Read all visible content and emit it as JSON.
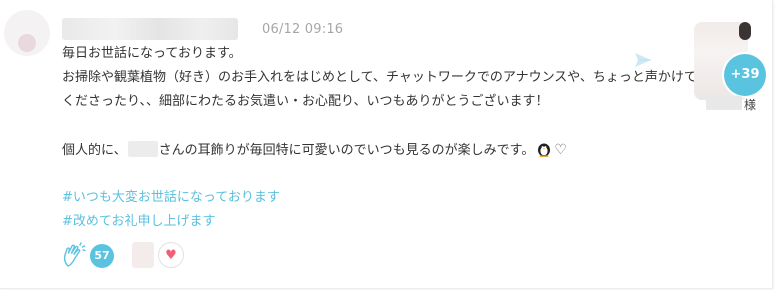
{
  "post": {
    "timestamp": "06/12 09:16",
    "lines": [
      "毎日お世話になっております。",
      "お掃除や観葉植物（好き）のお手入れをはじめとして、チャットワークでのアナウンスや、ちょっと声かけて",
      "くださったり、、細部にわたるお気遣い・お心配り、いつもありがとうございます！"
    ],
    "line4_prefix": "個人的に、",
    "line4_suffix": "さんの耳飾りが毎回特に可愛いのでいつも見るのが楽しみです。",
    "heart_outline": "♡",
    "hashtags": [
      "#いつも大変お世話になっております",
      "#改めてお礼申し上げます"
    ]
  },
  "recipients": {
    "extra_count": "+39",
    "name_suffix": "様"
  },
  "reactions": {
    "clap_count": "57",
    "heart_glyph": "♥"
  },
  "colors": {
    "accent": "#5ac3df",
    "hashtag": "#5bc0de",
    "heart": "#f06075",
    "timestamp": "#a7a7a7"
  },
  "icons": [
    "send-icon",
    "clap-icon",
    "penguin-emoji-icon",
    "heart-icon"
  ]
}
